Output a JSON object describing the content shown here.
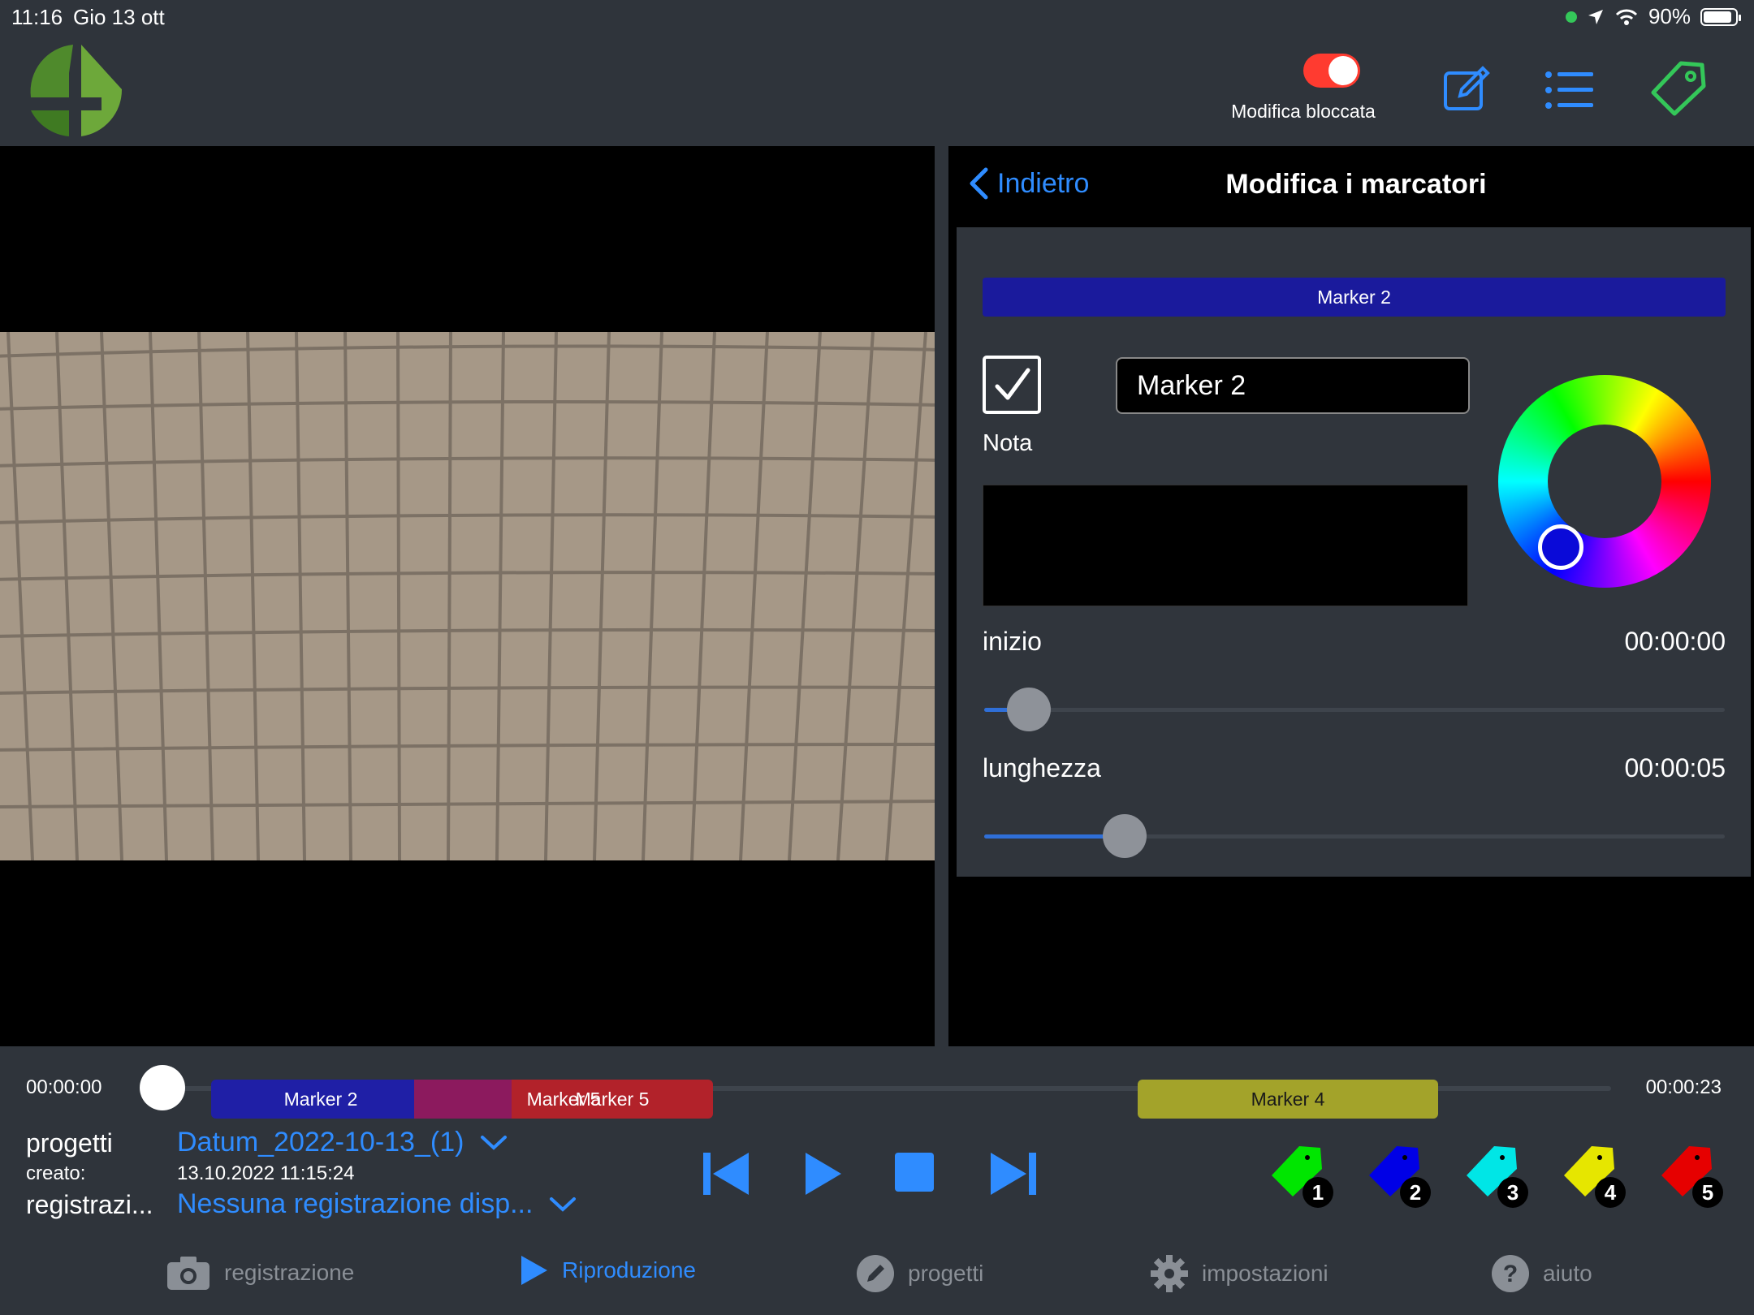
{
  "status_bar": {
    "time": "11:16",
    "date": "Gio 13 ott",
    "battery": "90%"
  },
  "header": {
    "edit_lock_label": "Modifica bloccata",
    "edit_lock_on": true
  },
  "panel": {
    "back_label": "Indietro",
    "title": "Modifica i marcatori",
    "marker_bar": "Marker 2",
    "marker_bar_color": "#1a1a9c",
    "checkbox_checked": true,
    "nota_label": "Nota",
    "name_value": "Marker 2",
    "note_value": "",
    "picked_color": "#0a0ad8",
    "start_label": "inizio",
    "start_value": "00:00:00",
    "start_position": 0.06,
    "length_label": "lunghezza",
    "length_value": "00:00:05",
    "length_position": 0.19
  },
  "timeline": {
    "start_time": "00:00:00",
    "end_time": "00:00:23",
    "playhead_position": 0.0,
    "segments": [
      {
        "label": "Marker 2",
        "color": "#1f1fa6"
      },
      {
        "label": "Marker 5",
        "color": "#b2222a"
      },
      {
        "label": "Marker 4",
        "color": "#a3a32a"
      }
    ]
  },
  "project": {
    "projects_label": "progetti",
    "project_name": "Datum_2022-10-13_(1)",
    "created_label": "creato:",
    "created_value": "13.10.2022 11:15:24",
    "recording_label": "registrazi...",
    "recording_value": "Nessuna registrazione disp..."
  },
  "marker_tags": [
    {
      "number": "1",
      "color": "#00e600"
    },
    {
      "number": "2",
      "color": "#0000e6"
    },
    {
      "number": "3",
      "color": "#00e6e6"
    },
    {
      "number": "4",
      "color": "#e6e600"
    },
    {
      "number": "5",
      "color": "#e60000"
    }
  ],
  "tabs": [
    {
      "label": "registrazione",
      "icon": "camera-icon",
      "active": false
    },
    {
      "label": "Riproduzione",
      "icon": "play-icon",
      "active": true
    },
    {
      "label": "progetti",
      "icon": "pencil-icon",
      "active": false
    },
    {
      "label": "impostazioni",
      "icon": "gear-icon",
      "active": false
    },
    {
      "label": "aiuto",
      "icon": "help-icon",
      "active": false
    }
  ]
}
